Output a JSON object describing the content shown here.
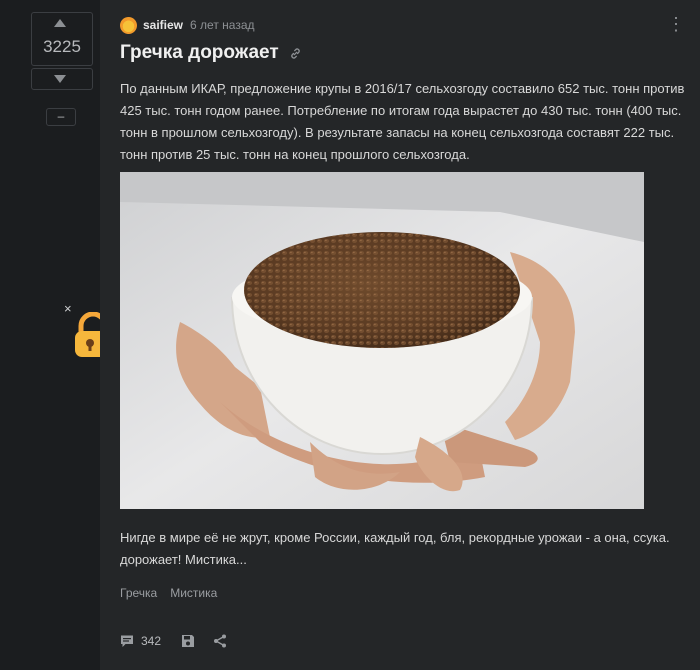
{
  "vote": {
    "score": "3225",
    "minus_label": "–"
  },
  "close_label": "×",
  "post": {
    "author": "saifiew",
    "time": "6 лет назад",
    "title": "Гречка дорожает",
    "body": "По данным ИКАР, предложение крупы в 2016/17 сельхозгоду составило 652 тыс. тонн против 425 тыс. тонн годом ранее. Потребление по итогам года вырастет до 430 тыс. тонн (400 тыс. тонн в прошлом сельхозгоду). В результате запасы на конец сельхозгода составят 222 тыс. тонн против 25 тыс. тонн на конец прошлого сельхозгода.",
    "caption": "Нигде в мире её не жрут, кроме России, каждый год, бля, рекордные урожаи - а она, ссука. дорожает! Мистика...",
    "tags": [
      "Гречка",
      "Мистика"
    ],
    "comments_count": "342"
  },
  "icons": {
    "vote_up": "chevron-up-icon",
    "vote_down": "chevron-down-icon",
    "menu": "more-vertical-icon",
    "link": "link-icon",
    "comments": "comment-icon",
    "save": "save-icon",
    "share": "share-icon",
    "lock": "lock-icon"
  },
  "colors": {
    "background": "#1b1d1f",
    "card": "#242628",
    "text": "#d8d8d8",
    "muted": "#8d9094",
    "avatar": "#f6c238"
  }
}
